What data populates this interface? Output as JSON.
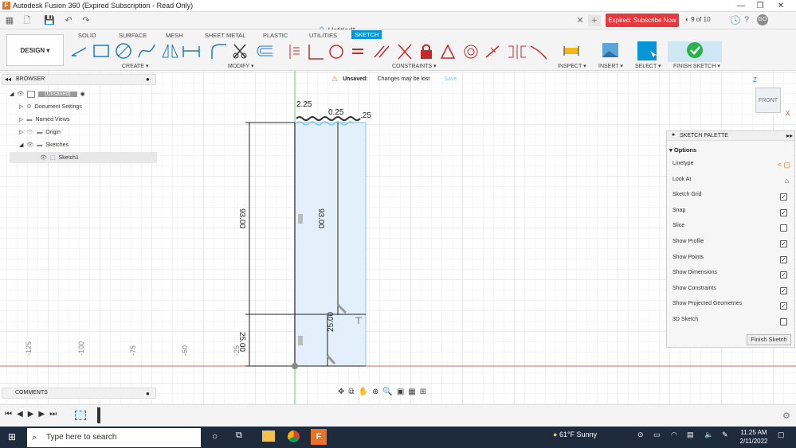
{
  "window": {
    "title": "Autodesk Fusion 360 (Expired Subscription - Read Only)"
  },
  "doc": {
    "tab": "Untitled*",
    "expired": "Expired: Subscribe Now",
    "jobs": "9 of 10",
    "user": "GO"
  },
  "ribbon": {
    "workspace": "DESIGN",
    "tabs": [
      "SOLID",
      "SURFACE",
      "MESH",
      "SHEET METAL",
      "PLASTIC",
      "UTILITIES",
      "SKETCH"
    ],
    "groups": {
      "create": "CREATE",
      "modify": "MODIFY",
      "constraints": "CONSTRAINTS",
      "inspect": "INSPECT",
      "insert": "INSERT",
      "select": "SELECT",
      "finish": "FINISH SKETCH"
    }
  },
  "browser": {
    "title": "BROWSER",
    "root": "(Unsaved)",
    "items": [
      "Document Settings",
      "Named Views",
      "Origin",
      "Sketches",
      "Sketch1"
    ]
  },
  "unsaved": {
    "label": "Unsaved:",
    "message": "Changes may be lost",
    "save": "Save"
  },
  "viewcube": {
    "label": "FRONT",
    "z": "Z",
    "x": "X"
  },
  "sketch": {
    "dims": {
      "top": "2.25",
      "d2": "0.25",
      "d3": ".25",
      "h_left": "93.00",
      "h_inner": "93.00",
      "b_left": "25.00",
      "b_inner": "25.00"
    },
    "axis_ticks": [
      "-125",
      "-100",
      "-75",
      "-50",
      "-25"
    ]
  },
  "palette": {
    "title": "SKETCH PALETTE",
    "section": "Options",
    "rows": [
      {
        "label": "Linetype",
        "type": "linetype"
      },
      {
        "label": "Look At",
        "type": "icon"
      },
      {
        "label": "Sketch Grid",
        "type": "check",
        "checked": true
      },
      {
        "label": "Snap",
        "type": "check",
        "checked": true
      },
      {
        "label": "Slice",
        "type": "check",
        "checked": false
      },
      {
        "label": "Show Profile",
        "type": "check",
        "checked": true
      },
      {
        "label": "Show Points",
        "type": "check",
        "checked": true
      },
      {
        "label": "Show Dimensions",
        "type": "check",
        "checked": true
      },
      {
        "label": "Show Constraints",
        "type": "check",
        "checked": true
      },
      {
        "label": "Show Projected Geometries",
        "type": "check",
        "checked": true
      },
      {
        "label": "3D Sketch",
        "type": "check",
        "checked": false
      }
    ],
    "finish": "Finish Sketch"
  },
  "comments": {
    "title": "COMMENTS"
  },
  "taskbar": {
    "search": "Type here to search",
    "weather": "61°F  Sunny",
    "time": "11:25 AM",
    "date": "2/11/2022"
  },
  "colors": {
    "accent": "#0696d7",
    "expired": "#e8383d",
    "finish": "#2bb34b"
  }
}
